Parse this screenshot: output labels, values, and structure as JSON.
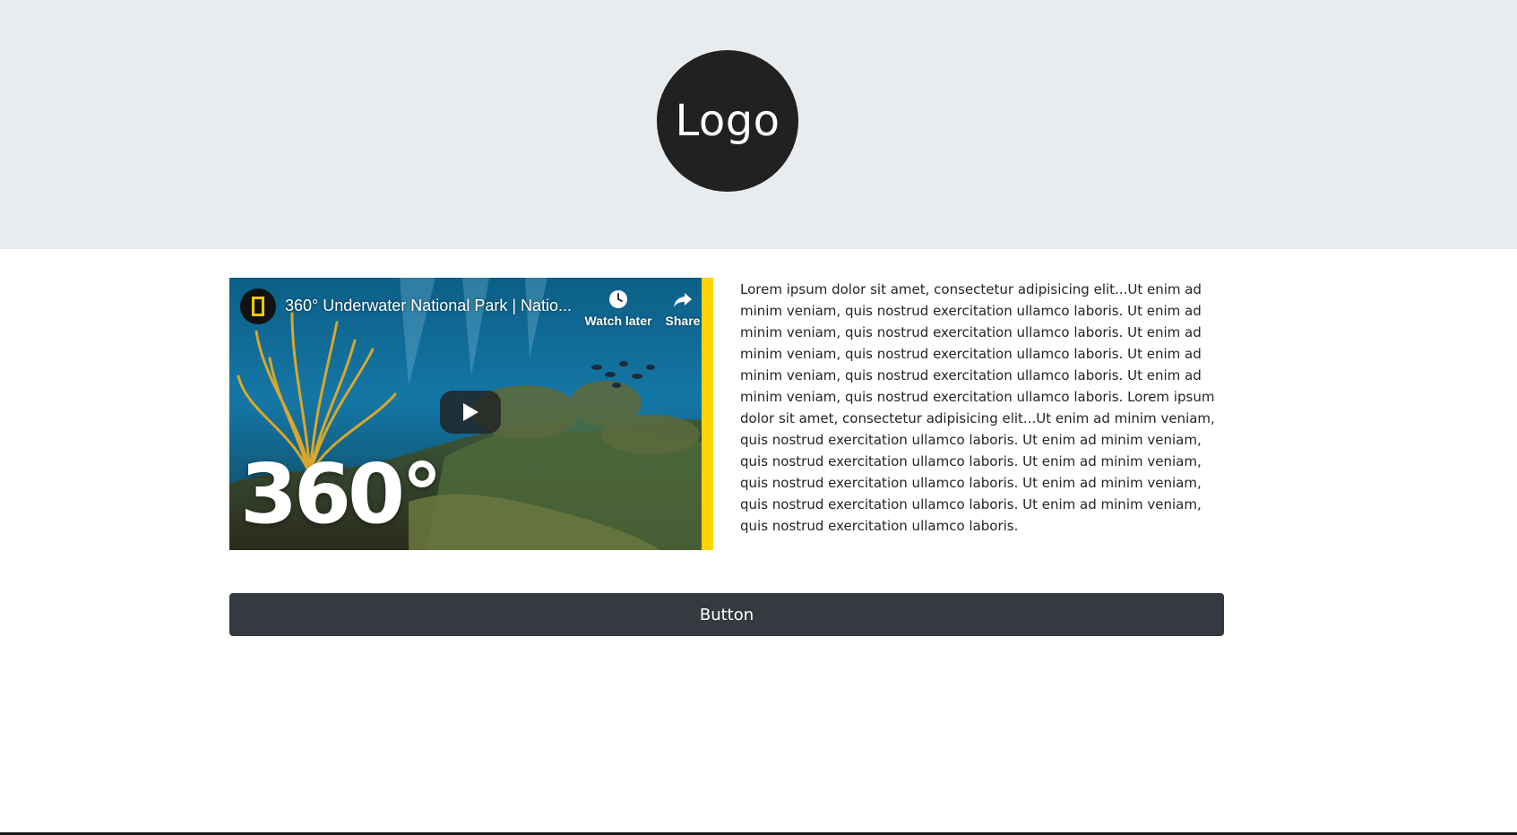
{
  "header": {
    "logo_text": "Logo",
    "background_color": "#e9ecef",
    "logo_color": "#212121"
  },
  "video": {
    "title": "360° Underwater National Park | Natio...",
    "watch_later_label": "Watch later",
    "share_label": "Share",
    "overlay_text": "360°",
    "icons": [
      "national-geographic-logo-icon",
      "clock-icon",
      "share-arrow-icon",
      "play-icon"
    ],
    "accent_color": "#ffd400"
  },
  "content": {
    "paragraph": "Lorem ipsum dolor sit amet, consectetur adipisicing elit...Ut enim ad minim veniam, quis nostrud exercitation ullamco laboris. Ut enim ad minim veniam, quis nostrud exercitation ullamco laboris. Ut enim ad minim veniam, quis nostrud exercitation ullamco laboris. Ut enim ad minim veniam, quis nostrud exercitation ullamco laboris. Ut enim ad minim veniam, quis nostrud exercitation ullamco laboris. Lorem ipsum dolor sit amet, consectetur adipisicing elit...Ut enim ad minim veniam, quis nostrud exercitation ullamco laboris. Ut enim ad minim veniam, quis nostrud exercitation ullamco laboris. Ut enim ad minim veniam, quis nostrud exercitation ullamco laboris. Ut enim ad minim veniam, quis nostrud exercitation ullamco laboris. Ut enim ad minim veniam, quis nostrud exercitation ullamco laboris."
  },
  "actions": {
    "button_label": "Button",
    "button_color": "#343a40"
  }
}
